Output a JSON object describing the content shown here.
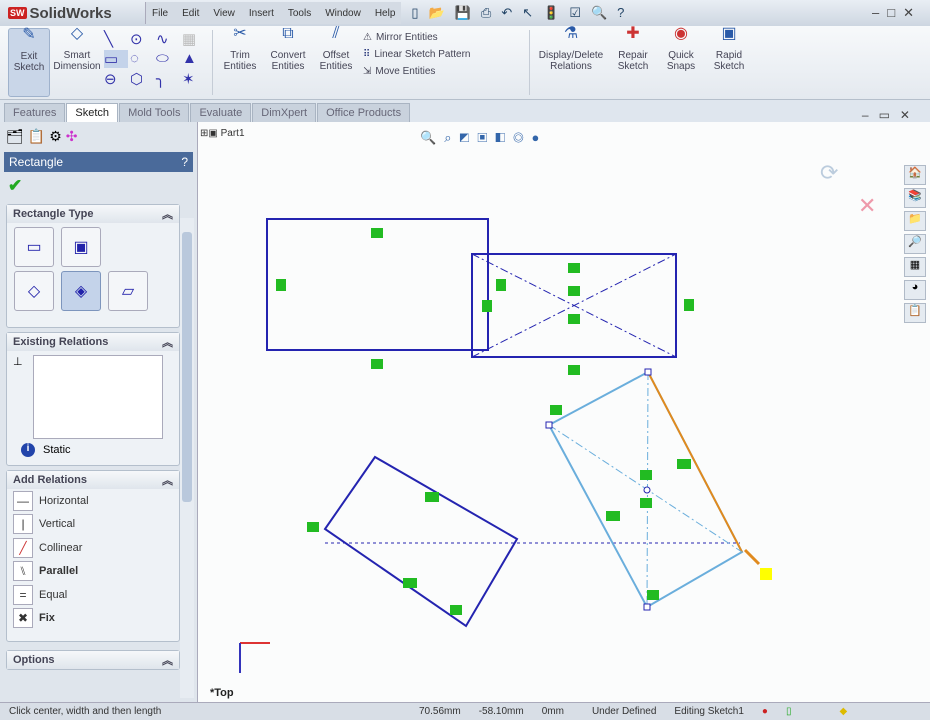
{
  "app": {
    "name": "SolidWorks"
  },
  "menu": [
    "File",
    "Edit",
    "View",
    "Insert",
    "Tools",
    "Window",
    "Help"
  ],
  "ribbon": {
    "exit_sketch": "Exit Sketch",
    "smart_dimension": "Smart Dimension",
    "trim": "Trim Entities",
    "convert": "Convert Entities",
    "offset": "Offset Entities",
    "mirror": "Mirror Entities",
    "linear_pattern": "Linear Sketch Pattern",
    "move": "Move Entities",
    "display_relations": "Display/Delete Relations",
    "repair": "Repair Sketch",
    "quick_snaps": "Quick Snaps",
    "rapid_sketch": "Rapid Sketch"
  },
  "tabs": [
    "Features",
    "Sketch",
    "Mold Tools",
    "Evaluate",
    "DimXpert",
    "Office Products"
  ],
  "active_tab": "Sketch",
  "property_manager": {
    "title": "Rectangle",
    "help": "?",
    "rect_type": "Rectangle Type",
    "existing_relations": "Existing Relations",
    "status": "Static",
    "add_relations": "Add Relations",
    "relations": [
      "Horizontal",
      "Vertical",
      "Collinear",
      "Parallel",
      "Equal",
      "Fix"
    ],
    "options": "Options"
  },
  "tree": {
    "part": "Part1"
  },
  "view": {
    "orientation": "*Top"
  },
  "status": {
    "prompt": "Click center, width and then length",
    "x": "70.56mm",
    "y": "-58.10mm",
    "z": "0mm",
    "state": "Under Defined",
    "editing": "Editing Sketch1"
  },
  "colors": {
    "sketch": "#2424b0",
    "selected": "#6aaedc",
    "relation": "#22bb22",
    "accent": "#e08a1e"
  }
}
